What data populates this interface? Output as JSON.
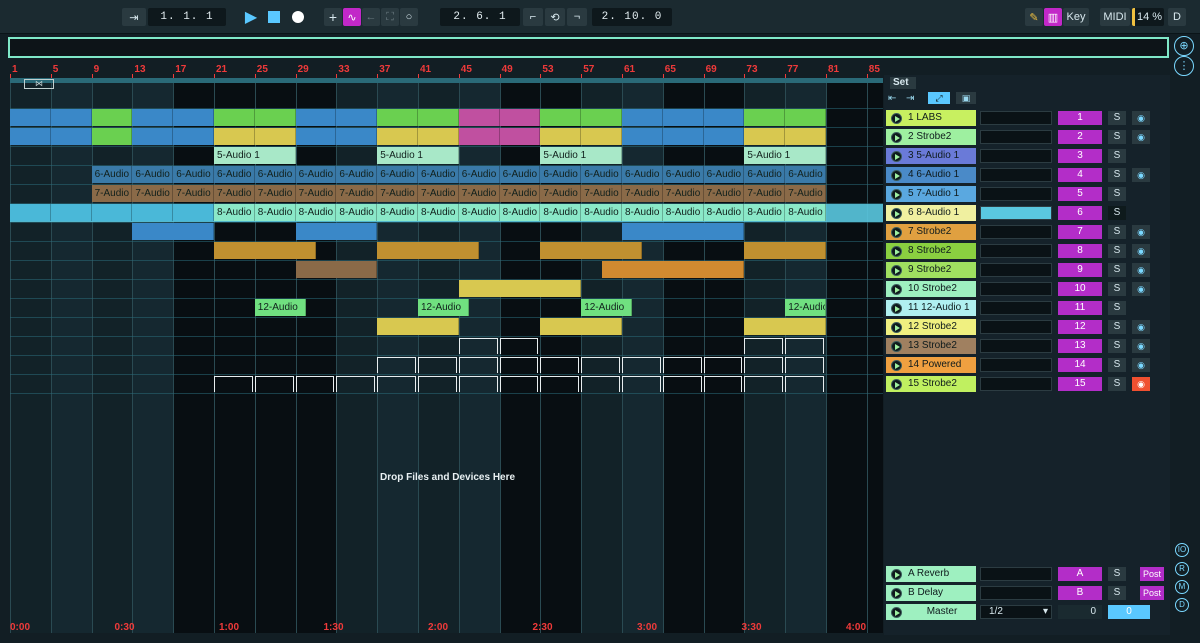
{
  "transport": {
    "position": "1. 1. 1",
    "loop_start": "2. 6. 1",
    "loop_length": "2. 10. 0"
  },
  "toolbar_right": {
    "key_label": "Key",
    "midi_label": "MIDI",
    "cpu": "14 %",
    "d_label": "D"
  },
  "ruler_bars": [
    "1",
    "5",
    "9",
    "13",
    "17",
    "21",
    "25",
    "29",
    "33",
    "37",
    "41",
    "45",
    "49",
    "53",
    "57",
    "61",
    "65",
    "69",
    "73",
    "77",
    "81",
    "85"
  ],
  "time_marks": [
    "0:00",
    "0:30",
    "1:00",
    "1:30",
    "2:00",
    "2:30",
    "3:00",
    "3:30",
    "4:00"
  ],
  "set_label": "Set",
  "drop_text": "Drop Files and Devices Here",
  "tracks": [
    {
      "name": "1 LABS",
      "color": "#c8f060",
      "num": "1",
      "arm": true,
      "armColor": "#7ad8ff"
    },
    {
      "name": "2 Strobe2",
      "color": "#9ef0a0",
      "num": "2",
      "arm": true,
      "armColor": "#7ad8ff"
    },
    {
      "name": "3 5-Audio 1",
      "color": "#6a7ad8",
      "num": "3",
      "arm": false
    },
    {
      "name": "4 6-Audio 1",
      "color": "#4a8ac8",
      "num": "4",
      "arm": true,
      "armColor": "#7ad8ff"
    },
    {
      "name": "5 7-Audio 1",
      "color": "#5aa8e0",
      "num": "5",
      "arm": false
    },
    {
      "name": "6 8-Audio 1",
      "color": "#f0f0a0",
      "num": "6",
      "arm": false,
      "selected": true
    },
    {
      "name": "7 Strobe2",
      "color": "#e0a040",
      "num": "7",
      "arm": true,
      "armColor": "#7ad8ff"
    },
    {
      "name": "8 Strobe2",
      "color": "#8ad040",
      "num": "8",
      "arm": true,
      "armColor": "#7ad8ff"
    },
    {
      "name": "9 Strobe2",
      "color": "#a0e060",
      "num": "9",
      "arm": true,
      "armColor": "#7ad8ff"
    },
    {
      "name": "10 Strobe2",
      "color": "#9ef0c0",
      "num": "10",
      "arm": true,
      "armColor": "#7ad8ff"
    },
    {
      "name": "11 12-Audio 1",
      "color": "#b0f0f0",
      "num": "11",
      "arm": false
    },
    {
      "name": "12 Strobe2",
      "color": "#f0f080",
      "num": "12",
      "arm": true,
      "armColor": "#7ad8ff"
    },
    {
      "name": "13 Strobe2",
      "color": "#a08060",
      "num": "13",
      "arm": true,
      "armColor": "#7ad8ff"
    },
    {
      "name": "14 Powered",
      "color": "#f0a040",
      "num": "14",
      "arm": true,
      "armColor": "#7ad8ff"
    },
    {
      "name": "15 Strobe2",
      "color": "#c0f060",
      "num": "15",
      "arm": true,
      "armColor": "#f05030"
    }
  ],
  "returns": [
    {
      "name": "A Reverb",
      "num": "A",
      "post": "Post"
    },
    {
      "name": "B Delay",
      "num": "B",
      "post": "Post"
    }
  ],
  "master": {
    "name": "Master",
    "routing": "1/2",
    "val1": "0",
    "val2": "0"
  },
  "side_buttons": [
    "IO",
    "R",
    "M",
    "D"
  ],
  "colors": {
    "accent": "#b32dc8",
    "ruler": "#f03a3a",
    "selected_row": "#5ac8e0"
  }
}
